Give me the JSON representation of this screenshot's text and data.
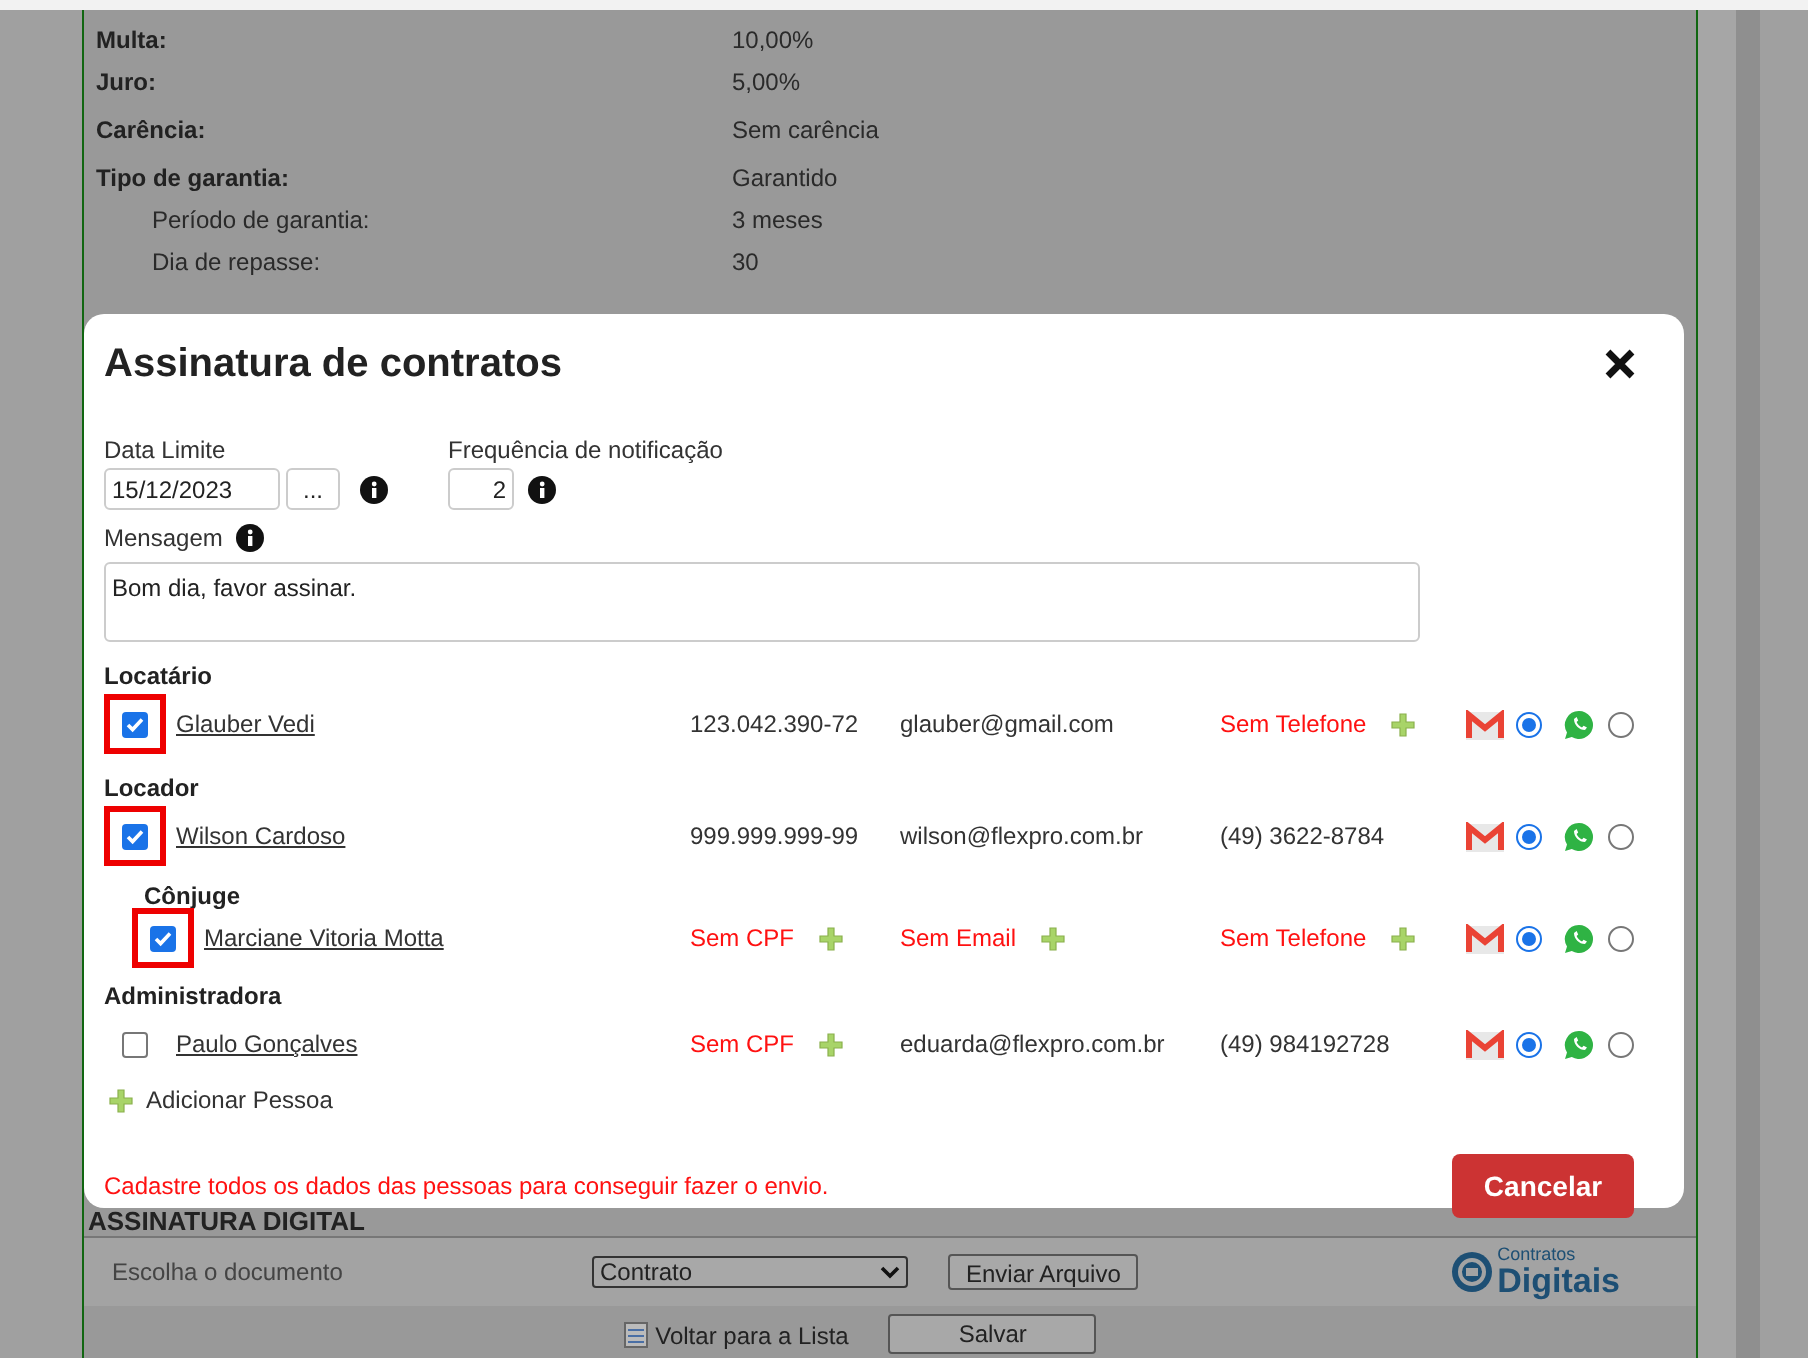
{
  "details": [
    {
      "label": "Multa:",
      "value": "10,00%",
      "sub": false
    },
    {
      "label": "Juro:",
      "value": "5,00%",
      "sub": false
    },
    {
      "label": "Carência:",
      "value": "Sem carência",
      "sub": false
    },
    {
      "label": "Tipo de garantia:",
      "value": "Garantido",
      "sub": false
    },
    {
      "label": "Período de garantia:",
      "value": "3 meses",
      "sub": true
    },
    {
      "label": "Dia de repasse:",
      "value": "30",
      "sub": true
    }
  ],
  "modal": {
    "title": "Assinatura de contratos",
    "date_label": "Data Limite",
    "date_value": "15/12/2023",
    "date_button": "...",
    "freq_label": "Frequência de notificação",
    "freq_value": "2",
    "message_label": "Mensagem",
    "message_value": "Bom dia, favor assinar.",
    "groups": [
      {
        "title": "Locatário",
        "people": [
          {
            "name": "Glauber Vedi",
            "checked": true,
            "flagged": true,
            "cpf": {
              "text": "123.042.390-72",
              "missing": false
            },
            "email": {
              "text": "glauber@gmail.com",
              "missing": false
            },
            "phone": {
              "text": "Sem Telefone",
              "missing": true
            },
            "email_channel": {
              "selected": true
            },
            "whatsapp_channel": {
              "selected": false
            }
          }
        ]
      },
      {
        "title": "Locador",
        "people": [
          {
            "name": "Wilson Cardoso",
            "checked": true,
            "flagged": true,
            "cpf": {
              "text": "999.999.999-99",
              "missing": false
            },
            "email": {
              "text": "wilson@flexpro.com.br",
              "missing": false
            },
            "phone": {
              "text": "(49) 3622-8784",
              "missing": false
            },
            "email_channel": {
              "selected": true
            },
            "whatsapp_channel": {
              "selected": false
            },
            "children": [
              {
                "title": "Cônjuge",
                "people": [
                  {
                    "name": "Marciane Vitoria Motta",
                    "checked": true,
                    "flagged": true,
                    "cpf": {
                      "text": "Sem CPF",
                      "missing": true
                    },
                    "email": {
                      "text": "Sem Email",
                      "missing": true
                    },
                    "phone": {
                      "text": "Sem Telefone",
                      "missing": true
                    },
                    "email_channel": {
                      "selected": true
                    },
                    "whatsapp_channel": {
                      "selected": false
                    }
                  }
                ]
              }
            ]
          }
        ]
      },
      {
        "title": "Administradora",
        "people": [
          {
            "name": "Paulo Gonçalves",
            "checked": false,
            "flagged": false,
            "cpf": {
              "text": "Sem CPF",
              "missing": true
            },
            "email": {
              "text": "eduarda@flexpro.com.br",
              "missing": false
            },
            "phone": {
              "text": "(49) 984192728",
              "missing": false
            },
            "email_channel": {
              "selected": true
            },
            "whatsapp_channel": {
              "selected": false
            }
          }
        ]
      }
    ],
    "add_person": "Adicionar Pessoa",
    "warning": "Cadastre todos os dados das pessoas para conseguir fazer o envio.",
    "cancel_button": "Cancelar"
  },
  "digital_signature": {
    "heading": "ASSINATURA DIGITAL",
    "choose_label": "Escolha o documento",
    "document_select": "Contrato",
    "send_button": "Enviar Arquivo",
    "logo_small": "Contratos",
    "logo_big": "Digitais",
    "back_link": "Voltar para a Lista",
    "save_button": "Salvar"
  }
}
